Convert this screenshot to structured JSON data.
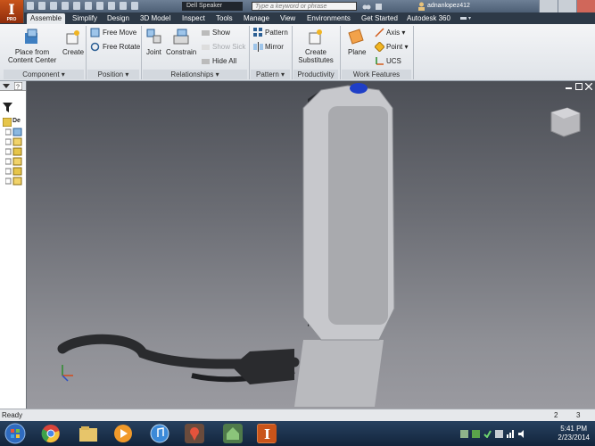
{
  "app": {
    "logo_letter": "I",
    "logo_sub": "PRO"
  },
  "titlebar": {
    "doc_title": "Dell Speaker",
    "search_placeholder": "Type a keyword or phrase",
    "user": "adnanlopez412"
  },
  "tabs": [
    {
      "label": "Assemble",
      "active": true
    },
    {
      "label": "Simplify"
    },
    {
      "label": "Design"
    },
    {
      "label": "3D Model"
    },
    {
      "label": "Inspect"
    },
    {
      "label": "Tools"
    },
    {
      "label": "Manage"
    },
    {
      "label": "View"
    },
    {
      "label": "Environments"
    },
    {
      "label": "Get Started"
    },
    {
      "label": "Autodesk 360"
    }
  ],
  "ribbon": {
    "component": {
      "label": "Component ▾",
      "place_from_cc_line1": "Place from",
      "place_from_cc_line2": "Content Center",
      "create": "Create"
    },
    "position": {
      "label": "Position ▾",
      "free_move": "Free Move",
      "free_rotate": "Free Rotate"
    },
    "relationships": {
      "label": "Relationships ▾",
      "joint": "Joint",
      "constrain": "Constrain",
      "show": "Show",
      "show_sick": "Show Sick",
      "hide_all": "Hide All"
    },
    "pattern": {
      "label": "Pattern ▾",
      "pattern": "Pattern",
      "mirror": "Mirror"
    },
    "productivity": {
      "label": "Productivity",
      "create_sub_line1": "Create",
      "create_sub_line2": "Substitutes"
    },
    "work_features": {
      "label": "Work Features",
      "plane": "Plane",
      "axis": "Axis ▾",
      "point": "Point ▾",
      "ucs": "UCS"
    }
  },
  "browser": {
    "header": "De"
  },
  "status": {
    "left": "Ready",
    "count1": "2",
    "count2": "3"
  },
  "clock": {
    "time": "5:41 PM",
    "date": "2/23/2014"
  },
  "colors": {
    "accent": "#c9541a",
    "tabbar": "#2d3947",
    "taskbar": "#1a3350"
  }
}
